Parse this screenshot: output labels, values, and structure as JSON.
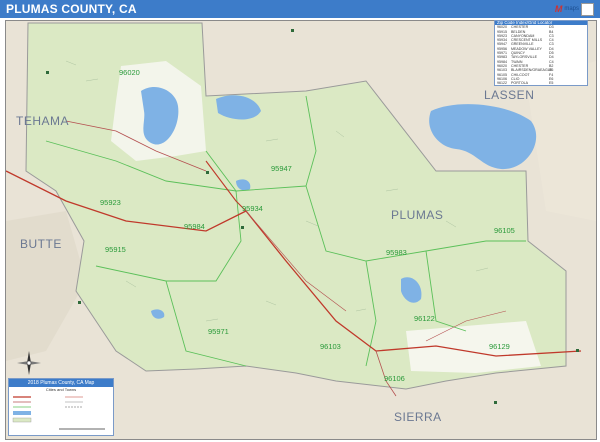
{
  "header": {
    "title": "PLUMAS COUNTY, CA"
  },
  "map": {
    "county_labels": [
      "TEHAMA",
      "BUTTE",
      "LASSEN",
      "SIERRA",
      "PLUMAS"
    ],
    "zip_labels": [
      "96020",
      "95947",
      "95923",
      "95984",
      "95934",
      "95915",
      "95983",
      "96105",
      "96122",
      "95971",
      "96103",
      "96129",
      "96106"
    ],
    "colors": {
      "county_fill": "#dbe9c4",
      "outside": "#e9e3d6",
      "water": "#7fb2e5",
      "zip_line": "#5cc05a",
      "road": "#b45050",
      "highway": "#c0392b",
      "header": "#3d7cc9"
    }
  },
  "zip_table": {
    "title": "Zip Code Index/Grid Locator",
    "rows": [
      [
        "96020",
        "CHESTER",
        "D3"
      ],
      [
        "95915",
        "BELDEN",
        "B4"
      ],
      [
        "95923",
        "CANYONDAM",
        "C3"
      ],
      [
        "95934",
        "CRESCENT MILLS",
        "C4"
      ],
      [
        "95947",
        "GREENVILLE",
        "C3"
      ],
      [
        "95956",
        "MEADOW VALLEY",
        "D4"
      ],
      [
        "95971",
        "QUINCY",
        "D5"
      ],
      [
        "95983",
        "TAYLORSVILLE",
        "D4"
      ],
      [
        "95984",
        "TWAIN",
        "C4"
      ],
      [
        "96020",
        "CHESTER",
        "B2"
      ],
      [
        "96103",
        "BLAIRSDEN/GRAEAGLE",
        "E6"
      ],
      [
        "96105",
        "CHILCOOT",
        "F4"
      ],
      [
        "96106",
        "CLIO",
        "E6"
      ],
      [
        "96122",
        "PORTOLA",
        "E5"
      ],
      [
        "96129",
        "BECKWOURTH",
        "E6"
      ],
      [
        "96135",
        "VINTON",
        "F5"
      ]
    ]
  },
  "legend": {
    "title": "2018 Plumas County, CA Map",
    "subtitle": "Cities and Towns"
  },
  "compass": {
    "label": "N"
  }
}
